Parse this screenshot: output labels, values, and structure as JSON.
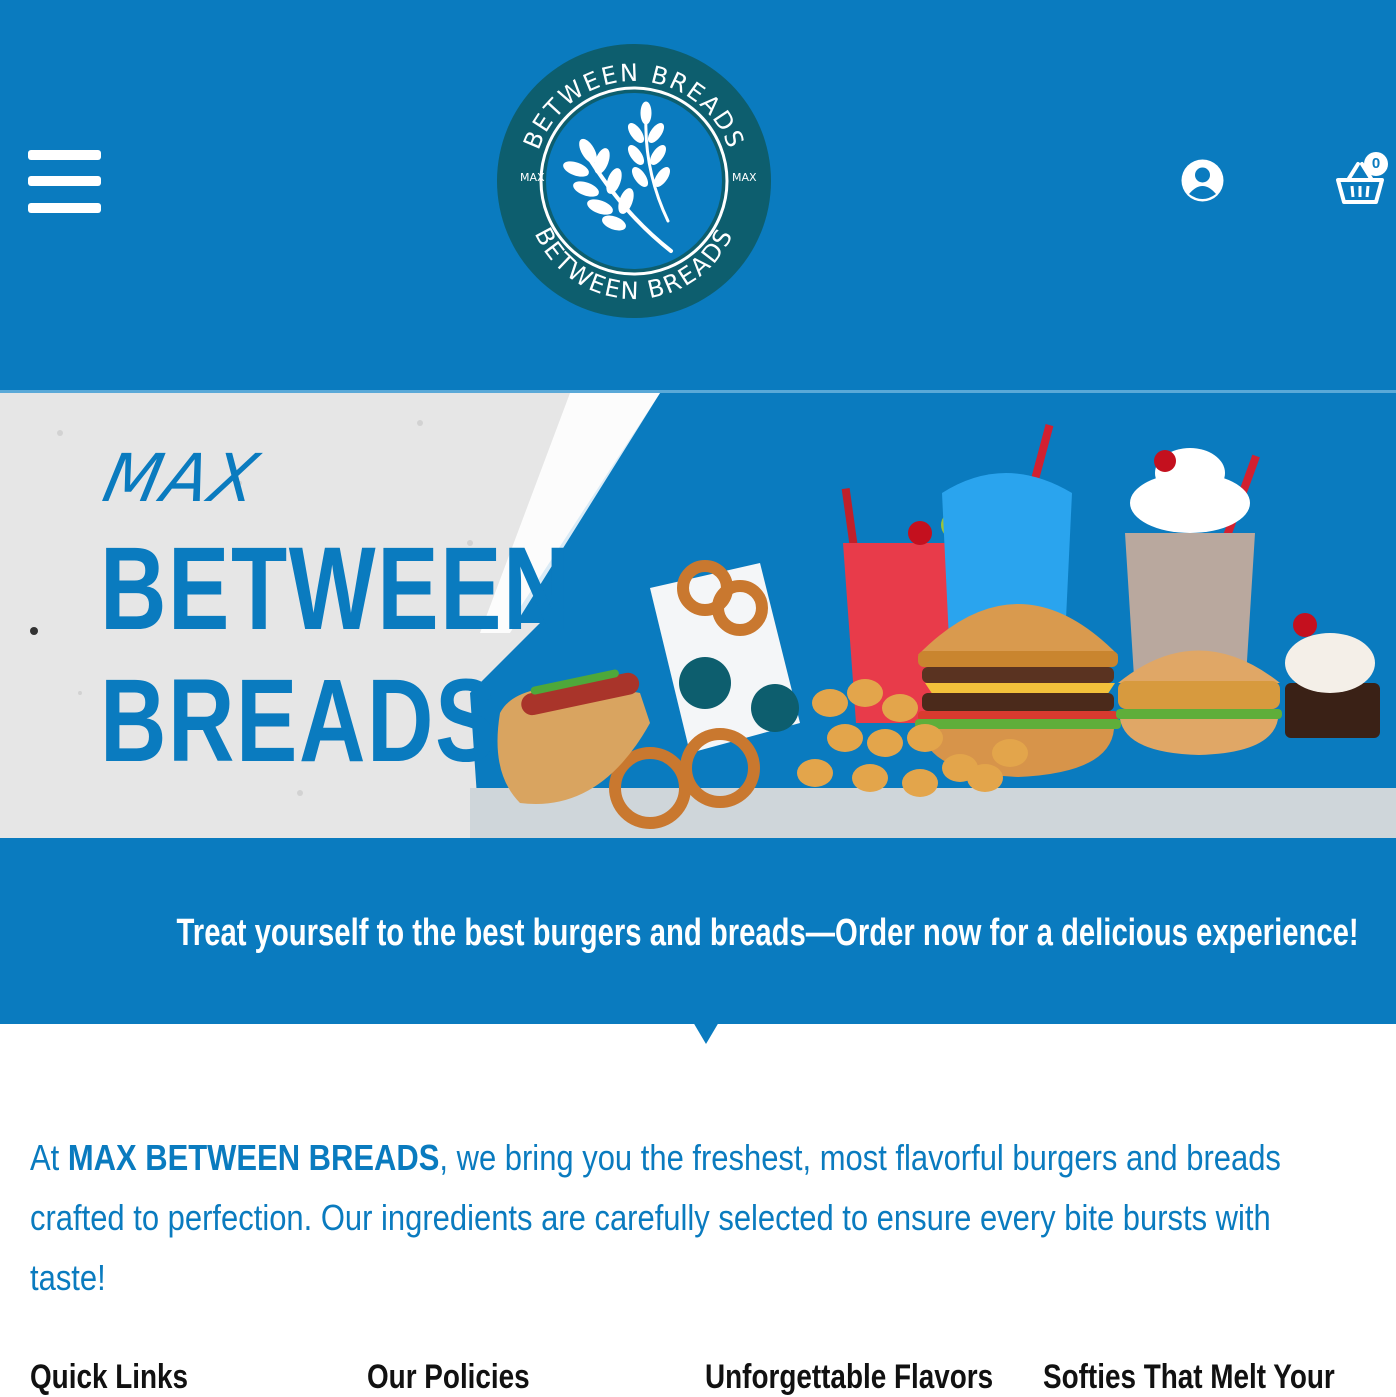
{
  "header": {
    "logo": {
      "ring_text_top": "BETWEEN BREADS",
      "ring_text_bottom": "BETWEEN BREADS",
      "left_label": "MAX",
      "right_label": "MAX"
    },
    "cart_count": "0",
    "colors": {
      "primary": "#0a7bbf",
      "logo_dark": "#0d5e6e"
    }
  },
  "hero": {
    "script_text": "MAX",
    "line1": "BETWEEN",
    "line2": "BREADS"
  },
  "tagline": "Treat yourself to the best burgers and breads—Order now for a delicious experience!",
  "intro": {
    "prefix": "At ",
    "brand": "MAX BETWEEN BREADS",
    "rest": ", we bring you the freshest, most flavorful burgers and breads crafted to perfection. Our ingredients are carefully selected to ensure every bite bursts with taste!"
  },
  "footer": {
    "headings": [
      "Quick Links",
      "Our Policies",
      "Unforgettable Flavors",
      "Softies That Melt Your"
    ]
  }
}
